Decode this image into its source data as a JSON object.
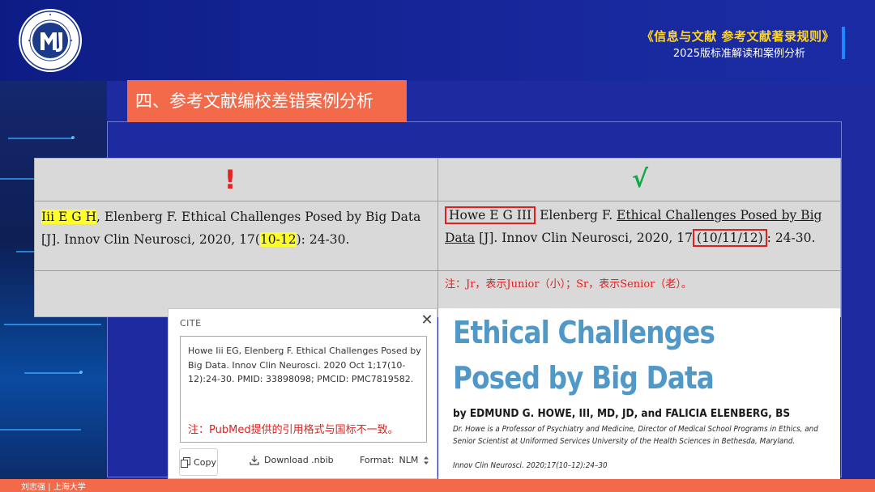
{
  "header": {
    "title_main": "《信息与文献 参考文献著录规则》",
    "title_sub": "2025版标准解读和案例分析",
    "logo_icon": "university-seal-icon"
  },
  "section": {
    "title": "四、参考文献编校差错案例分析"
  },
  "table": {
    "wrong_mark": "!",
    "right_mark": "√",
    "wrong": {
      "author_highlight": "Iii E G H",
      "part1": ", Elenberg F. Ethical Challenges Posed by Big Data [J]. Innov Clin Neurosci, 2020, 17(",
      "issue_highlight": "10-12",
      "part2": "): 24-30."
    },
    "right": {
      "author_boxed": "Howe E G III",
      "part1": " Elenberg F. ",
      "title_underlined": "Ethical Challenges Posed by Big Data",
      "part2": " [J]. Innov Clin Neurosci, 2020, 17",
      "issue_boxed": "(10/11/12)",
      "part3": ": 24-30."
    },
    "note": "注：Jr，表示Junior（小）；Sr，表示Senior（老）。"
  },
  "cite_dialog": {
    "title": "CITE",
    "close_label": "✕",
    "citation": "Howe Iii EG, Elenberg F. Ethical Challenges Posed by Big Data. Innov Clin Neurosci. 2020 Oct 1;17(10-12):24-30. PMID: 33898098; PMCID: PMC7819582.",
    "note": "注：PubMed提供的引用格式与国标不一致。",
    "copy_label": "Copy",
    "download_label": "Download .nbib",
    "format_label": "Format:",
    "format_value": "NLM"
  },
  "article": {
    "title": "Ethical Challenges Posed by Big Data",
    "authors": "by EDMUND G. HOWE, III, MD, JD, and FALICIA ELENBERG, BS",
    "description": "Dr. Howe is a Professor of Psychiatry and Medicine, Director of Medical School Programs in Ethics, and Senior Scientist at Uniformed Services University of the Health Sciences in Bethesda, Maryland.",
    "journal": "Innov Clin Neurosci. 2020;17(10–12):24–30"
  },
  "footer": {
    "text": "刘志强 | 上海大学"
  },
  "colors": {
    "header_blue": "#0d1c85",
    "panel_blue": "#1d2aa0",
    "accent_orange": "#f26a4a",
    "title_yellow": "#ffd52a",
    "wrong_red": "#e52121",
    "right_green": "#12a84a",
    "article_blue": "#4f98c8"
  }
}
